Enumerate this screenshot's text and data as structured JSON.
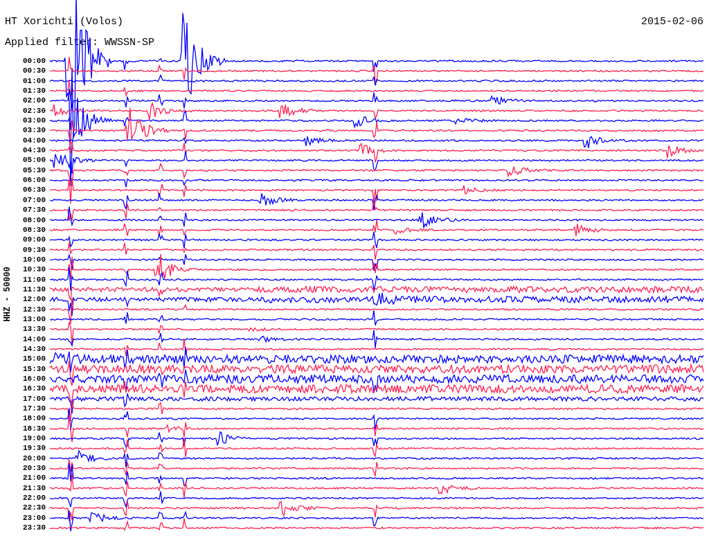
{
  "header": {
    "station": "HT Xorichti (Volos)",
    "date": "2015-02-06",
    "filter": "Applied filter: WWSSN-SP"
  },
  "plot": {
    "channel_label": "HHZ - 50000",
    "traces": [
      {
        "time": "00:00",
        "color": "#0000ff"
      },
      {
        "time": "00:30",
        "color": "#ff1f4f"
      },
      {
        "time": "01:00",
        "color": "#0000ff"
      },
      {
        "time": "01:30",
        "color": "#ff1f4f"
      },
      {
        "time": "02:00",
        "color": "#0000ff"
      },
      {
        "time": "02:30",
        "color": "#ff1f4f"
      },
      {
        "time": "03:00",
        "color": "#0000ff"
      },
      {
        "time": "03:30",
        "color": "#ff1f4f"
      },
      {
        "time": "04:00",
        "color": "#0000ff"
      },
      {
        "time": "04:30",
        "color": "#ff1f4f"
      },
      {
        "time": "05:00",
        "color": "#0000ff"
      },
      {
        "time": "05:30",
        "color": "#ff1f4f"
      },
      {
        "time": "06:00",
        "color": "#0000ff"
      },
      {
        "time": "06:30",
        "color": "#ff1f4f"
      },
      {
        "time": "07:00",
        "color": "#0000ff"
      },
      {
        "time": "07:30",
        "color": "#ff1f4f"
      },
      {
        "time": "08:00",
        "color": "#0000ff"
      },
      {
        "time": "08:30",
        "color": "#ff1f4f"
      },
      {
        "time": "09:00",
        "color": "#0000ff"
      },
      {
        "time": "09:30",
        "color": "#ff1f4f"
      },
      {
        "time": "10:00",
        "color": "#0000ff"
      },
      {
        "time": "10:30",
        "color": "#ff1f4f"
      },
      {
        "time": "11:00",
        "color": "#0000ff"
      },
      {
        "time": "11:30",
        "color": "#ff1f4f"
      },
      {
        "time": "12:00",
        "color": "#0000ff"
      },
      {
        "time": "12:30",
        "color": "#ff1f4f"
      },
      {
        "time": "13:00",
        "color": "#0000ff"
      },
      {
        "time": "13:30",
        "color": "#ff1f4f"
      },
      {
        "time": "14:00",
        "color": "#0000ff"
      },
      {
        "time": "14:30",
        "color": "#ff1f4f"
      },
      {
        "time": "15:00",
        "color": "#0000ff"
      },
      {
        "time": "15:30",
        "color": "#ff1f4f"
      },
      {
        "time": "16:00",
        "color": "#0000ff"
      },
      {
        "time": "16:30",
        "color": "#ff1f4f"
      },
      {
        "time": "17:00",
        "color": "#0000ff"
      },
      {
        "time": "17:30",
        "color": "#ff1f4f"
      },
      {
        "time": "18:00",
        "color": "#0000ff"
      },
      {
        "time": "18:30",
        "color": "#ff1f4f"
      },
      {
        "time": "19:00",
        "color": "#0000ff"
      },
      {
        "time": "19:30",
        "color": "#ff1f4f"
      },
      {
        "time": "20:00",
        "color": "#0000ff"
      },
      {
        "time": "20:30",
        "color": "#ff1f4f"
      },
      {
        "time": "21:00",
        "color": "#0000ff"
      },
      {
        "time": "21:30",
        "color": "#ff1f4f"
      },
      {
        "time": "22:00",
        "color": "#0000ff"
      },
      {
        "time": "22:30",
        "color": "#ff1f4f"
      },
      {
        "time": "23:00",
        "color": "#0000ff"
      },
      {
        "time": "23:30",
        "color": "#ff1f4f"
      }
    ]
  }
}
